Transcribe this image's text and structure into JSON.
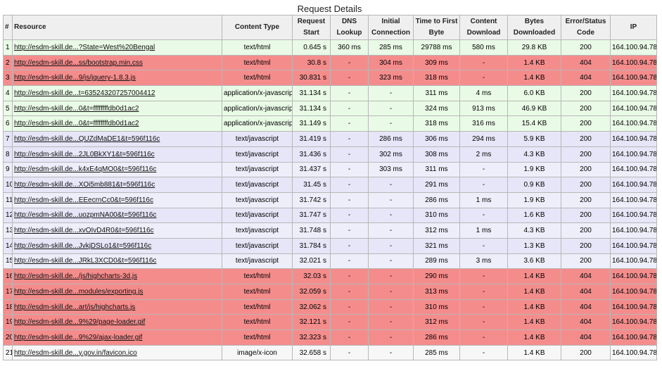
{
  "title": "Request Details",
  "columns": {
    "index": "#",
    "resource": "Resource",
    "content_type": "Content Type",
    "request_start": "Request Start",
    "dns_lookup": "DNS Lookup",
    "initial_connection": "Initial Connection",
    "ttfb": "Time to First Byte",
    "content_download": "Content Download",
    "bytes_downloaded": "Bytes Downloaded",
    "status": "Error/Status Code",
    "ip": "IP"
  },
  "rows": [
    {
      "n": "1",
      "resource": "http://esdm-skill.de...?State=West%20Bengal",
      "type": "text/html",
      "start": "0.645 s",
      "dns": "360 ms",
      "conn": "285 ms",
      "ttfb": "29788 ms",
      "dl": "580 ms",
      "bytes": "29.8 KB",
      "status": "200",
      "ip": "164.100.94.78",
      "style": "s-green"
    },
    {
      "n": "2",
      "resource": "http://esdm-skill.de...ss/bootstrap.min.css",
      "type": "text/html",
      "start": "30.8 s",
      "dns": "-",
      "conn": "304 ms",
      "ttfb": "309 ms",
      "dl": "-",
      "bytes": "1.4 KB",
      "status": "404",
      "ip": "164.100.94.78",
      "style": "s-red"
    },
    {
      "n": "3",
      "resource": "http://esdm-skill.de...9/js/jquery-1.8.3.js",
      "type": "text/html",
      "start": "30.831 s",
      "dns": "-",
      "conn": "323 ms",
      "ttfb": "318 ms",
      "dl": "-",
      "bytes": "1.4 KB",
      "status": "404",
      "ip": "164.100.94.78",
      "style": "s-red"
    },
    {
      "n": "4",
      "resource": "http://esdm-skill.de...t=635243207257004412",
      "type": "application/x-javascript",
      "start": "31.134 s",
      "dns": "-",
      "conn": "-",
      "ttfb": "311 ms",
      "dl": "4 ms",
      "bytes": "6.0 KB",
      "status": "200",
      "ip": "164.100.94.78",
      "style": "s-green"
    },
    {
      "n": "5",
      "resource": "http://esdm-skill.de...0&t=ffffffffdb0d1ac2",
      "type": "application/x-javascript",
      "start": "31.134 s",
      "dns": "-",
      "conn": "-",
      "ttfb": "324 ms",
      "dl": "913 ms",
      "bytes": "46.9 KB",
      "status": "200",
      "ip": "164.100.94.78",
      "style": "s-green"
    },
    {
      "n": "6",
      "resource": "http://esdm-skill.de...0&t=ffffffffdb0d1ac2",
      "type": "application/x-javascript",
      "start": "31.149 s",
      "dns": "-",
      "conn": "-",
      "ttfb": "318 ms",
      "dl": "316 ms",
      "bytes": "15.4 KB",
      "status": "200",
      "ip": "164.100.94.78",
      "style": "s-green"
    },
    {
      "n": "7",
      "resource": "http://esdm-skill.de...QUZdMaDE1&t=596f116c",
      "type": "text/javascript",
      "start": "31.419 s",
      "dns": "-",
      "conn": "286 ms",
      "ttfb": "306 ms",
      "dl": "294 ms",
      "bytes": "5.9 KB",
      "status": "200",
      "ip": "164.100.94.78",
      "style": "s-blue"
    },
    {
      "n": "8",
      "resource": "http://esdm-skill.de...2JL0BkXY1&t=596f116c",
      "type": "text/javascript",
      "start": "31.436 s",
      "dns": "-",
      "conn": "302 ms",
      "ttfb": "308 ms",
      "dl": "2 ms",
      "bytes": "4.3 KB",
      "status": "200",
      "ip": "164.100.94.78",
      "style": "s-blue"
    },
    {
      "n": "9",
      "resource": "http://esdm-skill.de...k4xE4qMO0&t=596f116c",
      "type": "text/javascript",
      "start": "31.437 s",
      "dns": "-",
      "conn": "303 ms",
      "ttfb": "311 ms",
      "dl": "-",
      "bytes": "1.9 KB",
      "status": "200",
      "ip": "164.100.94.78",
      "style": "s-blue-alt"
    },
    {
      "n": "10",
      "resource": "http://esdm-skill.de...XOi5mb881&t=596f116c",
      "type": "text/javascript",
      "start": "31.45 s",
      "dns": "-",
      "conn": "-",
      "ttfb": "291 ms",
      "dl": "-",
      "bytes": "0.9 KB",
      "status": "200",
      "ip": "164.100.94.78",
      "style": "s-blue"
    },
    {
      "n": "11",
      "resource": "http://esdm-skill.de...EEecrnCc0&t=596f116c",
      "type": "text/javascript",
      "start": "31.742 s",
      "dns": "-",
      "conn": "-",
      "ttfb": "286 ms",
      "dl": "1 ms",
      "bytes": "1.9 KB",
      "status": "200",
      "ip": "164.100.94.78",
      "style": "s-blue-alt"
    },
    {
      "n": "12",
      "resource": "http://esdm-skill.de...uozpmNA00&t=596f116c",
      "type": "text/javascript",
      "start": "31.747 s",
      "dns": "-",
      "conn": "-",
      "ttfb": "310 ms",
      "dl": "-",
      "bytes": "1.6 KB",
      "status": "200",
      "ip": "164.100.94.78",
      "style": "s-blue"
    },
    {
      "n": "13",
      "resource": "http://esdm-skill.de...xvOIvD4R0&t=596f116c",
      "type": "text/javascript",
      "start": "31.748 s",
      "dns": "-",
      "conn": "-",
      "ttfb": "312 ms",
      "dl": "1 ms",
      "bytes": "4.3 KB",
      "status": "200",
      "ip": "164.100.94.78",
      "style": "s-blue-alt"
    },
    {
      "n": "14",
      "resource": "http://esdm-skill.de...JvkjDSLo1&t=596f116c",
      "type": "text/javascript",
      "start": "31.784 s",
      "dns": "-",
      "conn": "-",
      "ttfb": "321 ms",
      "dl": "-",
      "bytes": "1.3 KB",
      "status": "200",
      "ip": "164.100.94.78",
      "style": "s-blue"
    },
    {
      "n": "15",
      "resource": "http://esdm-skill.de...JRkL3XCD0&t=596f116c",
      "type": "text/javascript",
      "start": "32.021 s",
      "dns": "-",
      "conn": "-",
      "ttfb": "289 ms",
      "dl": "3 ms",
      "bytes": "3.6 KB",
      "status": "200",
      "ip": "164.100.94.78",
      "style": "s-blue-alt"
    },
    {
      "n": "16",
      "resource": "http://esdm-skill.de.../js/highcharts-3d.js",
      "type": "text/html",
      "start": "32.03 s",
      "dns": "-",
      "conn": "-",
      "ttfb": "290 ms",
      "dl": "-",
      "bytes": "1.4 KB",
      "status": "404",
      "ip": "164.100.94.78",
      "style": "s-red"
    },
    {
      "n": "17",
      "resource": "http://esdm-skill.de...modules/exporting.js",
      "type": "text/html",
      "start": "32.059 s",
      "dns": "-",
      "conn": "-",
      "ttfb": "313 ms",
      "dl": "-",
      "bytes": "1.4 KB",
      "status": "404",
      "ip": "164.100.94.78",
      "style": "s-red"
    },
    {
      "n": "18",
      "resource": "http://esdm-skill.de...art/js/highcharts.js",
      "type": "text/html",
      "start": "32.062 s",
      "dns": "-",
      "conn": "-",
      "ttfb": "310 ms",
      "dl": "-",
      "bytes": "1.4 KB",
      "status": "404",
      "ip": "164.100.94.78",
      "style": "s-red"
    },
    {
      "n": "19",
      "resource": "http://esdm-skill.de...9%29/page-loader.gif",
      "type": "text/html",
      "start": "32.121 s",
      "dns": "-",
      "conn": "-",
      "ttfb": "312 ms",
      "dl": "-",
      "bytes": "1.4 KB",
      "status": "404",
      "ip": "164.100.94.78",
      "style": "s-red"
    },
    {
      "n": "20",
      "resource": "http://esdm-skill.de...9%29/ajax-loader.gif",
      "type": "text/html",
      "start": "32.323 s",
      "dns": "-",
      "conn": "-",
      "ttfb": "286 ms",
      "dl": "-",
      "bytes": "1.4 KB",
      "status": "404",
      "ip": "164.100.94.78",
      "style": "s-red"
    },
    {
      "n": "21",
      "resource": "http://esdm-skill.de...y.gov.in/favicon.ico",
      "type": "image/x-icon",
      "start": "32.658 s",
      "dns": "-",
      "conn": "-",
      "ttfb": "285 ms",
      "dl": "-",
      "bytes": "1.4 KB",
      "status": "200",
      "ip": "164.100.94.78",
      "style": "s-white"
    }
  ],
  "colors": {
    "success_row": "#e9fbe6",
    "error_row": "#f58c8c",
    "script_row": "#e6e6f8",
    "header_bg": "#efefef"
  }
}
